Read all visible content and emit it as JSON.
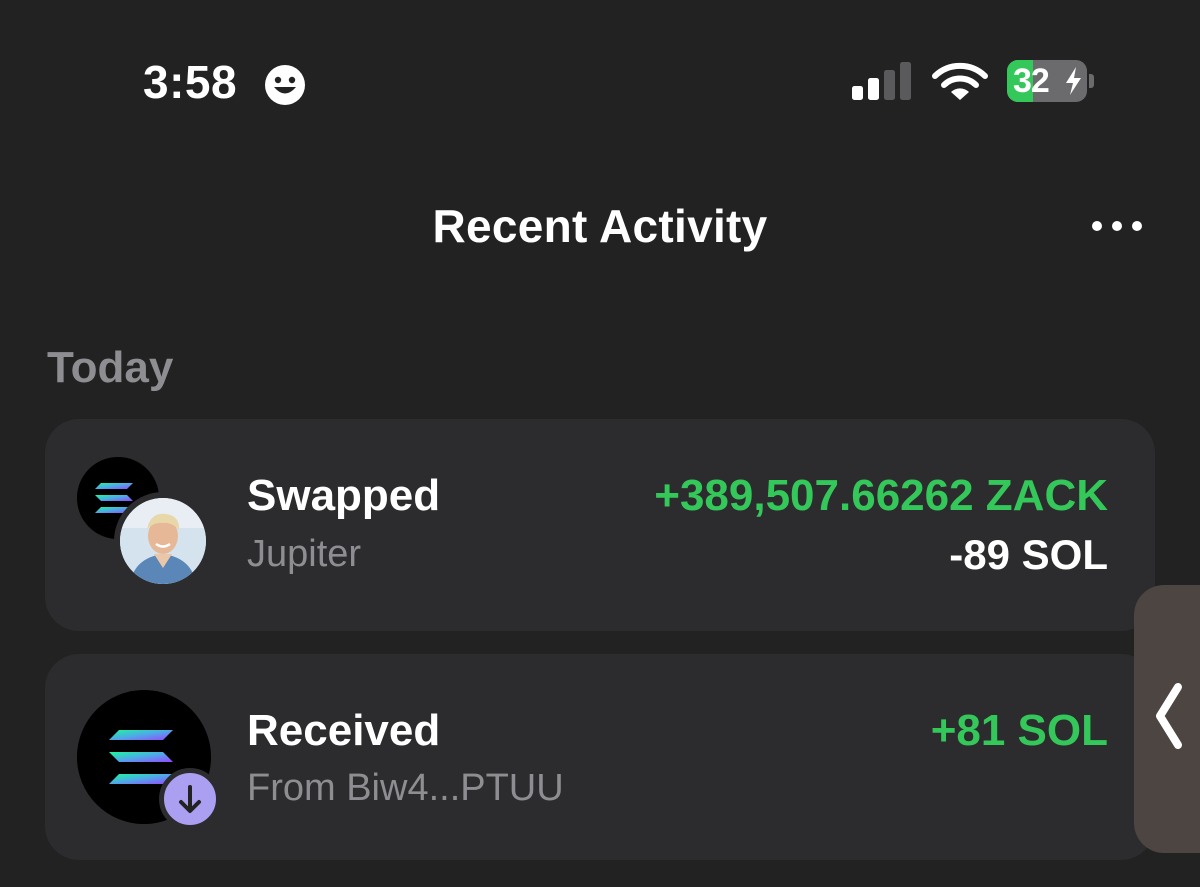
{
  "status_bar": {
    "time": "3:58",
    "battery_percent": "32",
    "battery_level": 0.32,
    "charging": true,
    "icons": [
      "smiley-face-icon",
      "cellular-signal-icon",
      "wifi-icon",
      "battery-charging-icon"
    ]
  },
  "header": {
    "title": "Recent Activity",
    "menu_icon": "more-horizontal-icon"
  },
  "sections": [
    {
      "heading": "Today",
      "items": [
        {
          "title": "Swapped",
          "subtitle": "Jupiter",
          "amount_primary": "+389,507.66262 ZACK",
          "amount_secondary": "-89 SOL",
          "icons": [
            "solana-logo-icon",
            "token-avatar-icon"
          ]
        },
        {
          "title": "Received",
          "subtitle": "From Biw4...PTUU",
          "amount_primary": "+81 SOL",
          "icons": [
            "solana-logo-icon",
            "arrow-down-icon"
          ]
        }
      ]
    }
  ],
  "side_handle": {
    "icon": "chevron-left-icon"
  },
  "colors": {
    "background": "#222223",
    "card": "#2c2c2e",
    "positive": "#34c759",
    "muted_text": "#8e8e92",
    "badge": "#ab9ff2",
    "handle": "#4c4542"
  }
}
